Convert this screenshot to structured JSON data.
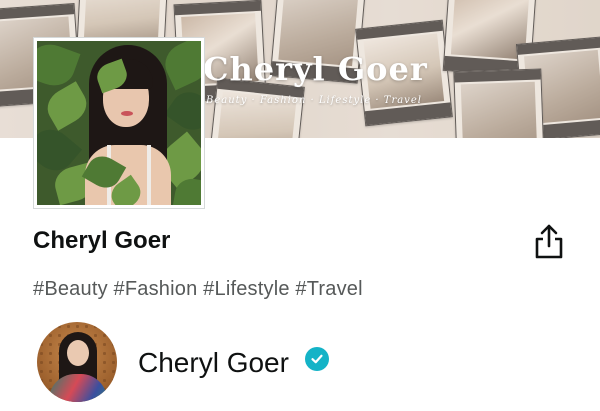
{
  "banner": {
    "title": "Cheryl Goer",
    "subtitle": "Beauty · Fashion · Lifestyle · Travel"
  },
  "store": {
    "name": "Cheryl Goer",
    "tags": "#Beauty #Fashion #Lifestyle #Travel"
  },
  "owner": {
    "name": "Cheryl Goer",
    "verified_icon": "verified-check-icon"
  },
  "colors": {
    "verified": "#14b3c7",
    "text": "#0f1111",
    "muted_text": "#565959"
  },
  "icons": {
    "share": "share-icon"
  }
}
